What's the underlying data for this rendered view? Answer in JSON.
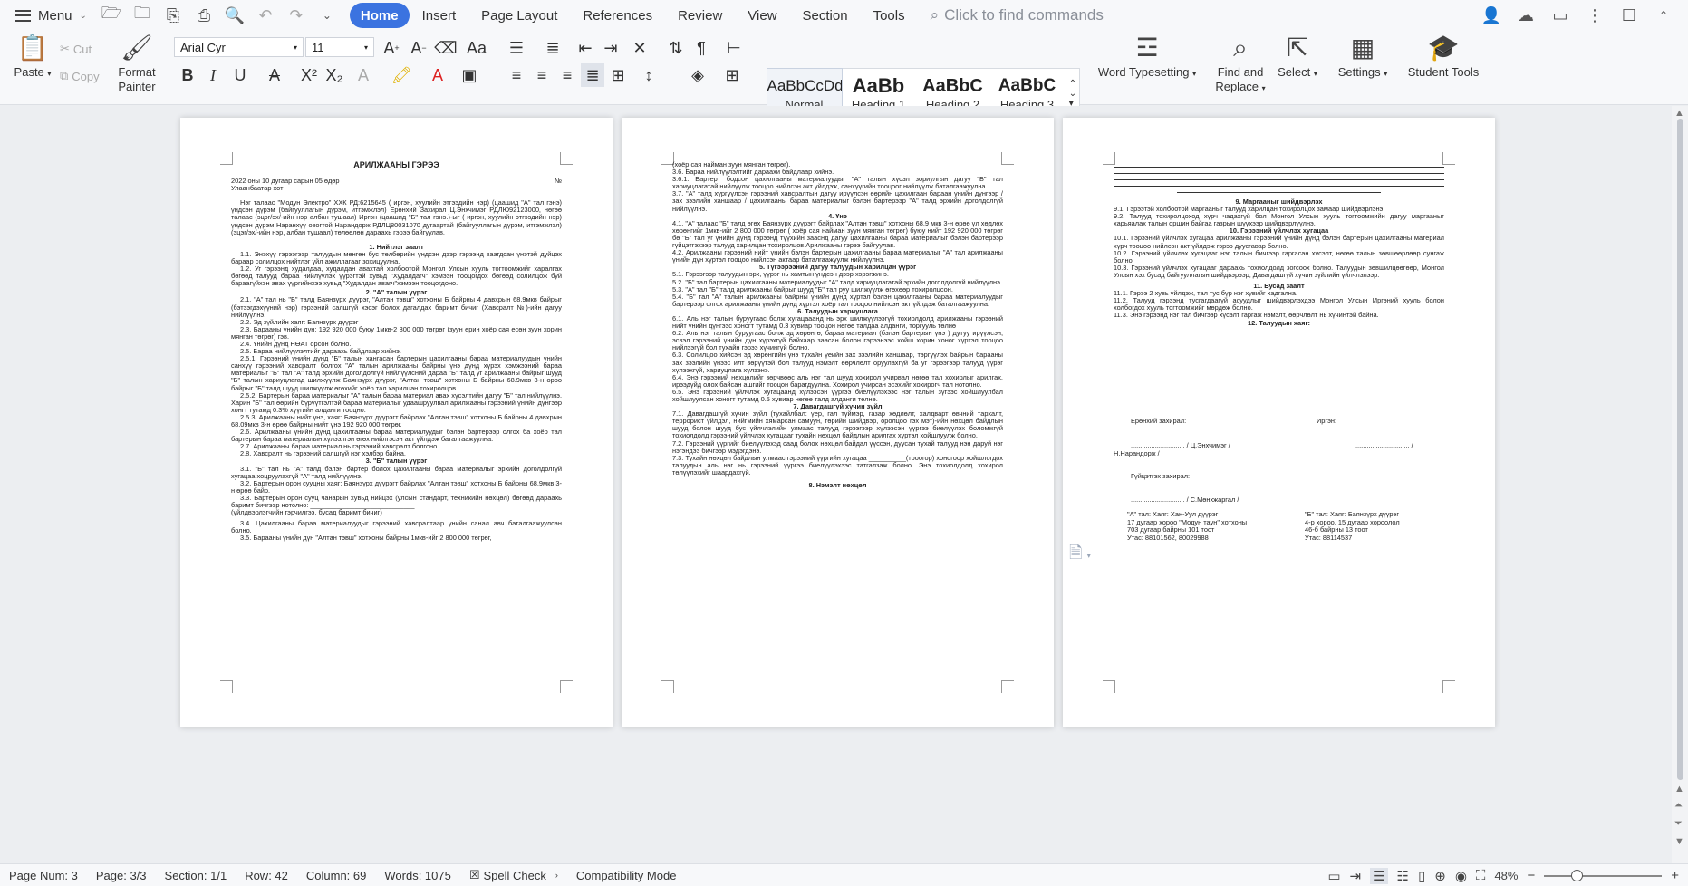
{
  "menubar": {
    "menu_label": "Menu",
    "tabs": [
      "Home",
      "Insert",
      "Page Layout",
      "References",
      "Review",
      "View",
      "Section",
      "Tools"
    ],
    "active_tab": "Home",
    "search_placeholder": "Click to find commands"
  },
  "ribbon": {
    "paste": "Paste",
    "cut": "Cut",
    "copy": "Copy",
    "format_painter_1": "Format",
    "format_painter_2": "Painter",
    "font_name": "Arial Cyr",
    "font_size": "11",
    "styles": [
      {
        "preview": "AaBbCcDd",
        "name": "Normal"
      },
      {
        "preview": "AaBb",
        "name": "Heading 1"
      },
      {
        "preview": "AaBbC",
        "name": "Heading 2"
      },
      {
        "preview": "AaBbC",
        "name": "Heading 3"
      }
    ],
    "word_typesetting": "Word Typesetting",
    "find_replace_1": "Find and",
    "find_replace_2": "Replace",
    "select": "Select",
    "settings": "Settings",
    "student_tools": "Student Tools"
  },
  "page1": {
    "title": "АРИЛЖААНЫ ГЭРЭЭ",
    "date_line": "2022 оны 10 дугаар сарын 05 өдөр",
    "no": "№",
    "city": "Улаанбаатар хот",
    "intro": "Нэг талаас \"Модун Электро\" ХХК РД:6215645 ( иргэн, хуулийн этгээдийн нэр) (цаашид \"А\" тал гэнэ) үндсэн дүрэм (байгууллагын дүрэм, итгэмжлэл) Ерөнхий Захирал Ц.Энхчимэг РДЛЮ92123000, нөгөө талаас (эцэг/эх/-ийн нэр албан тушаал) Иргэн (цаашид \"Б\" тал гэнэ.)-ыг ( иргэн, хуулийн этгээдийн нэр) үндсэн дүрэм Наранхүү овогтой Нарандорж РДЛЦ80031070 дугаартай (байгууллагын дүрэм, итгэмжлэл) (эцэг/эх/-ийн нэр, албан тушаал) төлөөлөн дараахь гэрээ байгуулав.",
    "s1_title": "1. Нийтлэг заалт",
    "s1_1": "1.1. Энэхүү гэрээгээр талуудын менген бус төлбөрийн үндсэн дээр гэрээнд заагдсан үнэтэй дүйцэх бараар солилцох нийтлэг үйл ажиллагааг зохицуулна.",
    "s1_2": "1.2. Уг гэрээнд худалдаа, худалдан авахтай холбоотой Монгол Улсын хууль тогтоомжийг харалгах бөгөөд талууд бараа нийлүүлэх үүрэгтэй хувьд \"Худалдагч\" хэмээн тооцогдох бөгөөд солилцож буй бараагүйхэн авах үүргийнхээ хувьд \"Худалдан авагч\"хэмээн тооцогдоно.",
    "s2_title": "2. \"А\" талын үүрэг",
    "s2_1": "2.1. \"А\" тал нь \"Б\" талд Баянзүрх дүүрэг, \"Алтан тэвш\" хотхоны Б байрны 4 давхрын 68.9мкв байрыг (бэтээгдэхүүний нэр) гэрээний салшгүй хэсэг болох дагалдах баримт бичиг (Хавсралт №)-ийн дагуу нийлүүлнэ.",
    "s2_2": "2.2. Эд зүйлийн хаяг: Баянзүрх дүүрэг",
    "s2_3": "2.3. Барааны үнийн дүн: 192 920 000 буюу 1мкв-2 800 000 төгрөг (зуун ерин хоёр сая есөн зуун хорин мянган төгрөг) гэв.",
    "s2_4": "2.4. Үнийн дүнд НӨАТ орсон болно.",
    "s2_5": "2.5. Бараа нийлүүлэлтийг дараахь байдлаар хийнэ.",
    "s2_5_1": "2.5.1. Гэрээний үнийн дүнд \"Б\" талын хангасан бартерын цахилгааны бараа материалуудын үнийн санхүү гэрээний хавсралт болгох \"А\" талын арилжааны байрны үнэ дүнд хүрэх хэмжээний бараа материалыг \"Б\" тал \"А\" талд эрхийн доголдолгүй нийлүүлсний дараа \"Б\" талд уг арилжааны байрыг шууд \"Б\" талын хариуцлагад шилжүүлж Баянзүрх дүүрэг, \"Алтан тэвш\" хотхоны Б байрны 68.9мкв 3-н өрөө байрыг \"Б\" талд шууд шилжүүлж өгөхийг хоёр тал харилцан тохиролцов.",
    "s2_5_2": "2.5.2. Бартерын бараа материалыг \"А\" талын бараа материал авах хүсэлтийн дагуу \"Б\" тал нийлүүлнэ. Харин \"Б\" тал өөрийн бүрүүтгэлтэй бараа материалыг удаашруулвал арилжааны гэрээний үнийн дүнгээр хонгт тутамд 0.3% хүүгийн алданги тооцно.",
    "s2_5_3": "2.5.3. Арилжааны нийт үнэ, хаяг: Баянзүрх дүүрэгт байрлах \"Алтан тэвш\" хотхоны Б байрны 4 давхрын 68.09мкв 3-н өрөө байрны нийт үнэ 192 920 000 төгрөг.",
    "s2_6": "2.6. Арилжааны үнийн дүнд цахилгааны бараа материалуудыг бэлэн бартерээр олгох ба хоёр тал бартерын бараа материалын хүлээлгэн өгөх нийлгэсэн акт үйлдэж баталгаажуулна.",
    "s2_7": "2.7. Арилжааны бараа материал нь гэрээний хавсралт болгоно.",
    "s2_8": "2.8. Хавсралт нь гэрээний салшгүй нэг хэлбэр байна.",
    "s3_title": "3. \"Б\" талын үүрэг",
    "s3_1": "3.1. \"Б\" тал нь \"А\" талд бэлэн бартер болох цахилгааны бараа материалыг эрхийн доголдолгүй хугацаа хоцруулахгүй \"А\" талд нийлүүлнэ.",
    "s3_2": "3.2. Бартерын орон сууцны хаяг: Баянзүрх дүүрэгт байрлах \"Алтан тэвш\" хотхоны Б байрны 68.9мкв 3-н өрөө байр.",
    "s3_3": "3.3. Бартерын орон сууц чанарын хувьд нийцэх (улсын стандарт, техникийн нөхцөл) бөгөөд дараахь баримт бичгээр нотолно: ____________________________",
    "s3_3b": "(үйлдвэрлэгчийн гэрчилгээ, бусад баримт бичиг)",
    "s3_4": "3.4. Цахилгааны бараа материалуудыг гэрээний хавсралтаар үнийн санал авч баталгаажуулсан болно.",
    "s3_5": "3.5. Барааны үнийн дүн \"Алтан тэвш\" хотхоны байрны 1мкв-ийг 2 800 000 төгрөг,"
  },
  "page2": {
    "l1": "(хоёр сая найман зуун мянган төгрөг).",
    "l2": "3.6. Бараа нийлүүлэлтийг дараахи байдлаар хийнэ.",
    "l3": "3.6.1. Бартерт бодсон цахилгааны материалуудыг \"А\" талын хүсэл зориулгын дагуу \"Б\" тал хариуцлагатай нийлүүлж тооцоо нийлсэн акт үйлдэж, санхүүгийн тооцоог нийлүүлж баталгаажуулна.",
    "l4": "3.7. \"А\" талд хүргүүлсэн гэрээний хавсралтын дагуу ирүүлсэн өөрийн цахилгаан бараан үнийн дүнгээр / зах зээлийн ханшаар / цахилгааны бараа материалыг бэлэн бартерээр \"А\" талд эрхийн доголдолгүй нийлүүлнэ.",
    "s4_title": "4. Үнэ",
    "s4_1": "4.1. \"А\" талаас \"Б\" талд өгөх Баянзүрх дүүрэгт байрлах \"Алтан тэвш\" хотхоны 68.9 мкв 3-н өрөө үл хөдлөх хөрөнгийг 1мкв-ийг 2 800 000 төгрөг ( хоёр сая найман зуун мянган төгрөг) буюу нийт 192 920 000 төгрөг бө \"Б\" тал уг үнийн дүнд гэрээнд түүхийн зааснд дагуу цахилгааны бараа материалыг бэлэн бартерээр гүйцэтгэхээр талууд харилцан тохиролцов.Арилжааны гэрээ байгуулав.",
    "s4_2": "4.2. Арилжааны гэрээний нийт үнийн бэлэн бартерын цахилгааны бараа материалыг \"А\" тал арилжааны үнийн дүн хүртэл тооцоо нийлсэн актаар баталгаажуулж нийлүүлнэ.",
    "s5_title": "5. Түгээрээний дагуу талуудын харилцан үүрэг",
    "s5_1": "5.1. Гэрээгээр талуудын эрх, үүрэг нь хамтын үндсэн дээр хэрэгжинэ.",
    "s5_2": "5.2. \"Б\" тал бартерын цахилгааны материалуудыг \"А\" талд хариуцлагатай эрхийн доголдолгүй нийлүүлнэ.",
    "s5_3": "5.3. \"А\" тал \"Б\" талд арилжааны байрыг шууд \"Б\" тал руу шилжүүлж өгөхөөр тохиролцсон.",
    "s5_4": "5.4. \"Б\" тал \"А\" талын арилжааны байрны үнийн дүнд хүртэл бэлэн цахилгааны бараа материалуудыг бартерээр олгох арилжааны үнийн дүнд хүртэл хоёр тал тооцоо нийлсэн акт үйлдэж баталгаажуулна.",
    "s6_title": "6. Талуудын хариуцлага",
    "s6_1": "6.1. Аль нэг талын буруугаас болж хугацааанд нь эрх шилжүүлээгүй тохиолдолд арилжааны гэрээний нийт үнийн дүнгээс хоногт тутамд 0.3 хувиар тооцон нөгөө талдаа алданги, торгууль төлнө",
    "s6_2": "6.2. Аль нэг талын буруугаас болж эд хөрөнгө, бараа материал (бэлэн бартерын үнэ ) дутуу ирүүлсэн, эсвэл гэрээний үнийн дүн хүрэхгүй байхаар заасан болон гэрээнээс хойш хорин хоног хүртэл тооцоо нийлээгүй бол тухайн гэрээ хүчингүй болно.",
    "s6_3": "6.3. Солилцоо хийсэн эд хөрөнгийн үнэ тухайн үеийн зах зээлийн ханшаар, тэргүүлэх байрын барааны зах зээлийн үнээс илт зөрүүтэй бол талууд нэмэлт өөрчлөлт оруулахгүй ба уг гэрээгээр талууд үүрэг хүлээхгүй, хариуцлага хүлээнэ.",
    "s6_4": "6.4. Энэ гэрээний нөхцөлийг зөрчвөөс аль нэг тал шууд хохирол учирвал нөгөө тал хохирлыг арилгах, ирээдүйд олох байсан ашгийг тооцон барагдуулна. Хохирол учирсан эсэхийг хохирогч тал нотолно.",
    "s6_5": "6.5. Энэ гэрээний үйлчлэх хугацаанд хүлээсэн үүргээ биелүүлэхээс нэг талын зүгээс хойшлуулбал хойшлуулсан хоногт тутамд 0.5 хувиар нөгөө талд алданги төлнө.",
    "s7_title": "7. Давагдашгүй хүчин зүйл",
    "s7_1": "7.1. Давагдашгүй хүчин зүйл (тухайлбал: үер, гал түймэр, газар хөдлөлт, халдварт өвчний тархалт, террорист үйлдэл, нийгмийн хямарсан самуун, төрийн шийдвэр, оролцоо гэх мэт)-ийн нөхцөл байдлын шууд болон шууд бус үйлчлэлийн улмаас талууд гэрээгээр хүлээсэн үүргээ биелүүлэх боломжгүй тохиолдолд гэрээний үйлчлэх хугацааг тухайн нөхцөл байдлын арилгах хүртэл хойшлуулж болно.",
    "s7_2": "7.2. Гэрээний үүргийг биелүүлэхэд саад болох нөхцөл байдал үүссэн, дуусан тухай талууд нэн даруй нэг нэгэндээ бичгээр мэдэгдэнэ.",
    "s7_3": "7.3. Тухайн нөхцөл байдлын улмаас гэрээний үүргийн хугацаа __________(тооогор) хоногоор хойшлогдох талуудын аль нэг нь гэрээний үүргээ биелүүлэхээс татгалзаж болно. Энэ тохиолдолд хохирол төлүүлэхийг шаардахгүй.",
    "s8_title": "8. Нэмэлт нөхцөл"
  },
  "page3": {
    "s9_title": "9. Маргааныг шийдвэрлэх",
    "s9_1": "9.1. Гэрээтэй холбоотой маргааныг талууд харилцан тохиролцох замаар шийдвэрлэнэ.",
    "s9_2": "9.2. Талууд тохиролцоход хүрч чадахгүй бол Монгол Улсын хууль тогтоомжийн дагуу маргааныг харьяалах талын оршин байгаа газрын шүүхээр шийдвэрлүүлнэ.",
    "s10_title": "10. Гэрээний үйлчлэх хугацаа",
    "s10_1": "10.1. Гэрээний үйлчлэх хугацаа арилжааны гэрээний үнийн дүнд бэлэн бартерын цахилгааны материал хүрч тооцоо нийлсэн акт үйлдэж гэрээ дуусгавар болно.",
    "s10_2": "10.2. Гэрээний үйлчлэх хугацааг нэг талын бичгээр гаргасан хүсэлт, нөгөө талын зөвшөөрлөөр сунгаж болно.",
    "s10_3": "10.3. Гэрээний үйлчлэх хугацааг дараахь тохиолдолд зогсоох болно. Талуудын зөвшилцөөгөөр, Монгол Улсын хэх бусад байгууллагын шийдвэрээр, Давагдашгүй хүчин зүйлийн үйлчлэлээр.",
    "s11_title": "11. Бусад заалт",
    "s11_1": "11.1. Гэрээ 2 хувь үйлдэж, тал тус бүр нэг хувийг хадгална.",
    "s11_2": "11.2. Талууд гэрээнд тусгагдаагүй асуудлыг шийдвэрлэхдээ Монгол Улсын Иргэний хууль болон холбогдох хууль тогтоомжийг мөрдөж болно.",
    "s11_3": "11.3. Энэ гэрээнд нэг тал бичгээр хүсэлт гаргаж нэмэлт, өөрчлөлт нь хүчинтэй байна.",
    "s12_title": "12. Талуудын хаяг:",
    "a_side": "Ерөнхий захирал:",
    "b_side": "Иргэн:",
    "sign_a": "............................. /  Ц.Энхчимэг  /",
    "sign_b": "............................. /",
    "name_b": "Н.Нарандорж /",
    "exec_dir": "Гүйцэтгэх захирал:",
    "sign_c": "............................. / С.Мөнхжаргал /",
    "addr_a_1": "\"А\" тал: Хаяг: Хан-Уул дүүрэг",
    "addr_a_2": "17 дугаар хороо \"Модун таун\" хотхоны",
    "addr_a_3": "703 дугаар байрны 101 тоот",
    "addr_a_4": "Утас: 88101562, 80029988",
    "addr_b_1": "\"Б\" тал: Хаяг: Баянзүрх дүүрэг",
    "addr_b_2": "4-р хороо, 15 дугаар хороолол",
    "addr_b_3": "46-б байрны 13 тоот",
    "addr_b_4": "Утас: 88114537"
  },
  "status": {
    "page_num": "Page Num: 3",
    "page": "Page: 3/3",
    "section": "Section: 1/1",
    "row": "Row: 42",
    "column": "Column: 69",
    "words": "Words: 1075",
    "spell_check": "Spell Check",
    "compat": "Compatibility Mode",
    "zoom": "48%"
  }
}
